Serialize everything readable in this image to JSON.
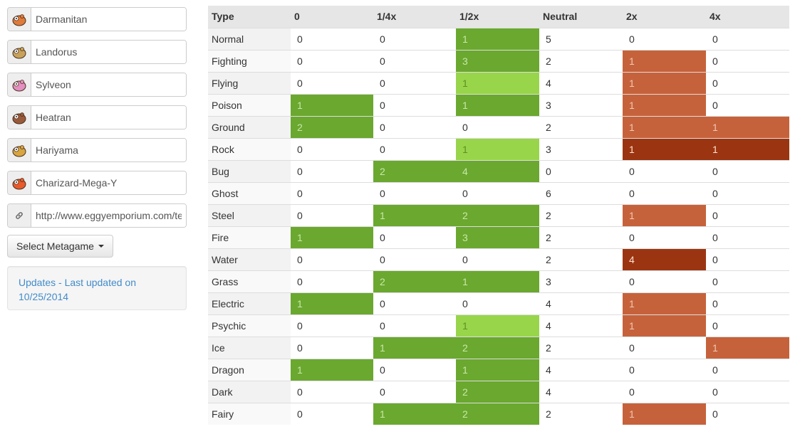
{
  "pokemon": [
    {
      "name": "Darmanitan",
      "icon": "darmanitan-sprite-icon",
      "color": "#e07a3a"
    },
    {
      "name": "Landorus",
      "icon": "landorus-sprite-icon",
      "color": "#c9a25a"
    },
    {
      "name": "Sylveon",
      "icon": "sylveon-sprite-icon",
      "color": "#e38fbf"
    },
    {
      "name": "Heatran",
      "icon": "heatran-sprite-icon",
      "color": "#9a5a3a"
    },
    {
      "name": "Hariyama",
      "icon": "hariyama-sprite-icon",
      "color": "#d8a540"
    },
    {
      "name": "Charizard-Mega-Y",
      "icon": "charizard-sprite-icon",
      "color": "#e85a2a"
    }
  ],
  "url_field": {
    "value": "http://www.eggyemporium.com/teambuilder",
    "icon": "link-icon"
  },
  "metagame_button": "Select Metagame",
  "updates_link": "Updates - Last updated on 10/25/2014",
  "colors": {
    "good": "#6aa82f",
    "slightly_good": "#98d54a",
    "weak": "#c6623b",
    "very_weak": "#9b3511",
    "header": "#e6e6e6"
  },
  "table": {
    "headers": [
      "Type",
      "0",
      "1/4x",
      "1/2x",
      "Neutral",
      "2x",
      "4x"
    ],
    "rows": [
      {
        "type": "Normal",
        "vals": [
          "0",
          "0",
          "1",
          "5",
          "0",
          "0"
        ],
        "cls": [
          "",
          "",
          "gd",
          "",
          "",
          ""
        ]
      },
      {
        "type": "Fighting",
        "vals": [
          "0",
          "0",
          "3",
          "2",
          "1",
          "0"
        ],
        "cls": [
          "",
          "",
          "gd",
          "",
          "rl",
          ""
        ]
      },
      {
        "type": "Flying",
        "vals": [
          "0",
          "0",
          "1",
          "4",
          "1",
          "0"
        ],
        "cls": [
          "",
          "",
          "gl",
          "",
          "rl",
          ""
        ]
      },
      {
        "type": "Poison",
        "vals": [
          "1",
          "0",
          "1",
          "3",
          "1",
          "0"
        ],
        "cls": [
          "gd",
          "",
          "gd",
          "",
          "rl",
          ""
        ]
      },
      {
        "type": "Ground",
        "vals": [
          "2",
          "0",
          "0",
          "2",
          "1",
          "1"
        ],
        "cls": [
          "gd",
          "",
          "",
          "",
          "rl",
          "rl"
        ]
      },
      {
        "type": "Rock",
        "vals": [
          "0",
          "0",
          "1",
          "3",
          "1",
          "1"
        ],
        "cls": [
          "",
          "",
          "gl",
          "",
          "rd",
          "rd"
        ]
      },
      {
        "type": "Bug",
        "vals": [
          "0",
          "2",
          "4",
          "0",
          "0",
          "0"
        ],
        "cls": [
          "",
          "gd",
          "gd",
          "",
          "",
          ""
        ]
      },
      {
        "type": "Ghost",
        "vals": [
          "0",
          "0",
          "0",
          "6",
          "0",
          "0"
        ],
        "cls": [
          "",
          "",
          "",
          "",
          "",
          ""
        ]
      },
      {
        "type": "Steel",
        "vals": [
          "0",
          "1",
          "2",
          "2",
          "1",
          "0"
        ],
        "cls": [
          "",
          "gd",
          "gd",
          "",
          "rl",
          ""
        ]
      },
      {
        "type": "Fire",
        "vals": [
          "1",
          "0",
          "3",
          "2",
          "0",
          "0"
        ],
        "cls": [
          "gd",
          "",
          "gd",
          "",
          "",
          ""
        ]
      },
      {
        "type": "Water",
        "vals": [
          "0",
          "0",
          "0",
          "2",
          "4",
          "0"
        ],
        "cls": [
          "",
          "",
          "",
          "",
          "rd",
          ""
        ]
      },
      {
        "type": "Grass",
        "vals": [
          "0",
          "2",
          "1",
          "3",
          "0",
          "0"
        ],
        "cls": [
          "",
          "gd",
          "gd",
          "",
          "",
          ""
        ]
      },
      {
        "type": "Electric",
        "vals": [
          "1",
          "0",
          "0",
          "4",
          "1",
          "0"
        ],
        "cls": [
          "gd",
          "",
          "",
          "",
          "rl",
          ""
        ]
      },
      {
        "type": "Psychic",
        "vals": [
          "0",
          "0",
          "1",
          "4",
          "1",
          "0"
        ],
        "cls": [
          "",
          "",
          "gl",
          "",
          "rl",
          ""
        ]
      },
      {
        "type": "Ice",
        "vals": [
          "0",
          "1",
          "2",
          "2",
          "0",
          "1"
        ],
        "cls": [
          "",
          "gd",
          "gd",
          "",
          "",
          "rl"
        ]
      },
      {
        "type": "Dragon",
        "vals": [
          "1",
          "0",
          "1",
          "4",
          "0",
          "0"
        ],
        "cls": [
          "gd",
          "",
          "gd",
          "",
          "",
          ""
        ]
      },
      {
        "type": "Dark",
        "vals": [
          "0",
          "0",
          "2",
          "4",
          "0",
          "0"
        ],
        "cls": [
          "",
          "",
          "gd",
          "",
          "",
          ""
        ]
      },
      {
        "type": "Fairy",
        "vals": [
          "0",
          "1",
          "2",
          "2",
          "1",
          "0"
        ],
        "cls": [
          "",
          "gd",
          "gd",
          "",
          "rl",
          ""
        ]
      }
    ]
  }
}
